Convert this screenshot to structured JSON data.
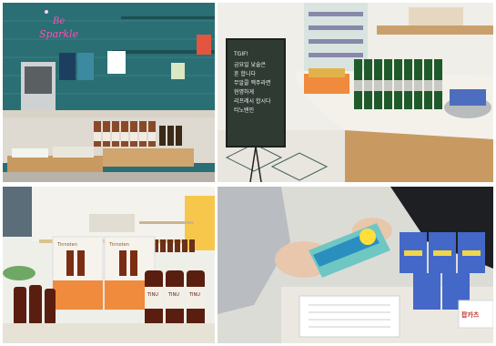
{
  "collage": {
    "panels": [
      {
        "id": "cafe-counter",
        "neon_sign_line1": "Be",
        "neon_sign_line2": "Sparkle"
      },
      {
        "id": "store-shelf",
        "sign_lines": [
          "TGIF!",
          "금요일 낮술은",
          "흔 합니다",
          "무알콜 맥주라면",
          "현명하게",
          "리프레시 합시다",
          "티노텐인"
        ]
      },
      {
        "id": "product-display",
        "box_brand": "Tinnoten",
        "product_label": "TINU"
      },
      {
        "id": "checkout",
        "badge": "팝카츠"
      }
    ]
  },
  "colors": {
    "teal_wall": "#2a6f73",
    "neon_pink": "#ff4fb8",
    "counter_wood": "#c89a62",
    "chalkboard": "#2f3a33",
    "bottle_green": "#1f5a2a",
    "display_orange": "#f08a3c"
  }
}
